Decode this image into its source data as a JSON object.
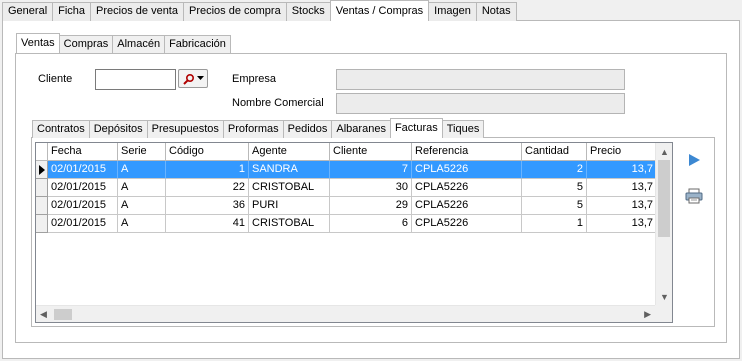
{
  "top_tabs": [
    "General",
    "Ficha",
    "Precios de venta",
    "Precios de compra",
    "Stocks",
    "Ventas / Compras",
    "Imagen",
    "Notas"
  ],
  "top_active": "Ventas / Compras",
  "sub_tabs": [
    "Ventas",
    "Compras",
    "Almacén",
    "Fabricación"
  ],
  "sub_active": "Ventas",
  "client": {
    "cliente_label": "Cliente",
    "cliente_value": "",
    "empresa_label": "Empresa",
    "empresa_value": "",
    "nombre_comercial_label": "Nombre Comercial",
    "nombre_comercial_value": ""
  },
  "doc_tabs": [
    "Contratos",
    "Depósitos",
    "Presupuestos",
    "Proformas",
    "Pedidos",
    "Albaranes",
    "Facturas",
    "Tiques"
  ],
  "doc_active": "Facturas",
  "grid": {
    "columns": [
      "Fecha",
      "Serie",
      "Código",
      "Agente",
      "Cliente",
      "Referencia",
      "Cantidad",
      "Precio"
    ],
    "rows": [
      [
        "02/01/2015",
        "A",
        "1",
        "SANDRA",
        "7",
        "CPLA5226",
        "2",
        "13,7"
      ],
      [
        "02/01/2015",
        "A",
        "22",
        "CRISTOBAL",
        "30",
        "CPLA5226",
        "5",
        "13,7"
      ],
      [
        "02/01/2015",
        "A",
        "36",
        "PURI",
        "29",
        "CPLA5226",
        "5",
        "13,7"
      ],
      [
        "02/01/2015",
        "A",
        "41",
        "CRISTOBAL",
        "6",
        "CPLA5226",
        "1",
        "13,7"
      ]
    ],
    "selected_row": 0
  },
  "icons": {
    "search": "magnifier-icon",
    "next": "play-arrow-icon",
    "print": "printer-icon"
  },
  "colors": {
    "selection": "#3399ff",
    "next_arrow": "#3c88d2"
  }
}
